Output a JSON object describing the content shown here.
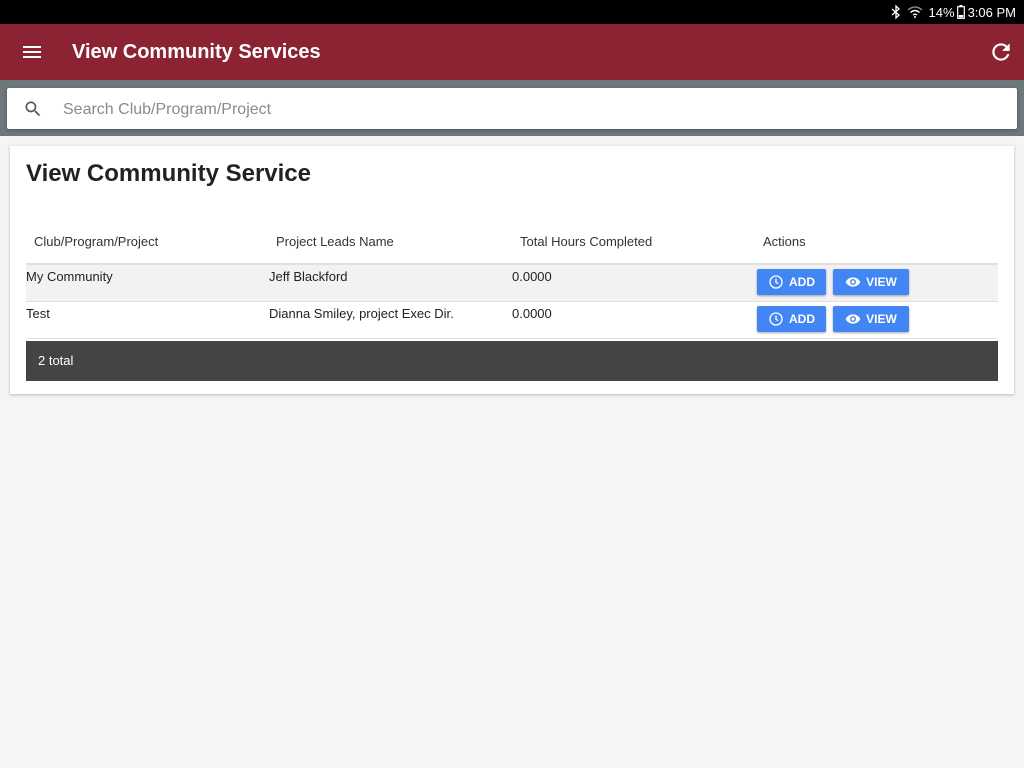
{
  "status_bar": {
    "battery": "14%",
    "time": "3:06 PM",
    "icons": [
      "bluetooth-icon",
      "wifi-icon",
      "battery-icon"
    ]
  },
  "app_bar": {
    "title": "View Community Services",
    "icons": [
      "menu-icon",
      "refresh-icon"
    ]
  },
  "search": {
    "placeholder": "Search Club/Program/Project",
    "value": ""
  },
  "card": {
    "title": "View Community Service",
    "table": {
      "headers": [
        "Club/Program/Project",
        "Project Leads Name",
        "Total Hours Completed",
        "Actions"
      ],
      "rows": [
        {
          "project": "My Community",
          "leads": "Jeff Blackford",
          "hours": "0.0000",
          "add_label": "ADD",
          "view_label": "VIEW"
        },
        {
          "project": "Test",
          "leads": "Dianna Smiley, project Exec Dir.",
          "hours": "0.0000",
          "add_label": "ADD",
          "view_label": "VIEW"
        }
      ]
    },
    "footer": "2 total"
  },
  "colors": {
    "app_bar": "#8b2332",
    "search_strip": "#6e777c",
    "button": "#4285f4",
    "footer": "#444444"
  }
}
